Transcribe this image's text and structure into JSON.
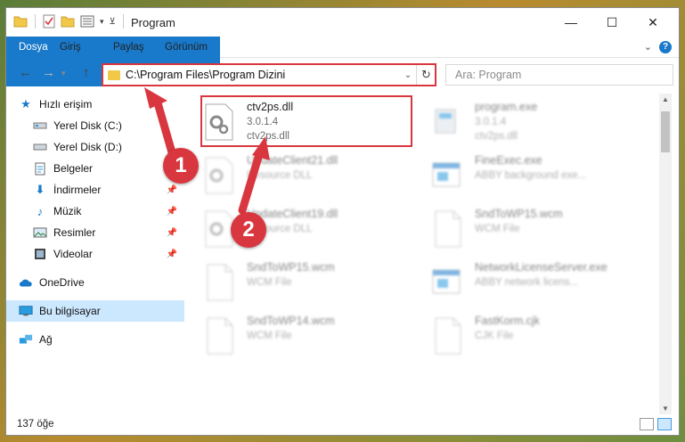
{
  "window": {
    "title": "Program",
    "controls": {
      "minimize": "—",
      "maximize": "☐",
      "close": "✕"
    }
  },
  "ribbon": {
    "tabs": [
      "Dosya",
      "Giriş",
      "Paylaş",
      "Görünüm"
    ],
    "help": "?"
  },
  "address_bar": {
    "path": "C:\\Program Files\\Program Dizini",
    "search_placeholder": "Ara: Program"
  },
  "sidebar": {
    "quick_access": "Hızlı erişim",
    "items": [
      {
        "label": "Yerel Disk (C:)",
        "icon": "drive-icon"
      },
      {
        "label": "Yerel Disk (D:)",
        "icon": "drive-icon"
      },
      {
        "label": "Belgeler",
        "icon": "documents-icon"
      },
      {
        "label": "İndirmeler",
        "icon": "downloads-icon",
        "pinned": true
      },
      {
        "label": "Müzik",
        "icon": "music-icon",
        "pinned": true
      },
      {
        "label": "Resimler",
        "icon": "pictures-icon",
        "pinned": true
      },
      {
        "label": "Videolar",
        "icon": "videos-icon",
        "pinned": true
      }
    ],
    "onedrive": "OneDrive",
    "this_pc": "Bu bilgisayar",
    "network": "Ağ"
  },
  "files": [
    {
      "name": "ctv2ps.dll",
      "line1": "3.0.1.4",
      "line2": "ctv2ps.dll",
      "icon": "dll-gear-icon",
      "highlighted": true
    },
    {
      "name": "program.exe",
      "line1": "3.0.1.4",
      "line2": "ctv2ps.dll",
      "icon": "exe-icon"
    },
    {
      "name": "UpdateClient21.dll",
      "line1": "Resource DLL",
      "line2": "",
      "icon": "dll-gear-icon"
    },
    {
      "name": "FineExec.exe",
      "line1": "ABBY background exe...",
      "line2": "",
      "icon": "app-window-icon"
    },
    {
      "name": "UpdateClient19.dll",
      "line1": "Resource DLL",
      "line2": "",
      "icon": "dll-gear-icon"
    },
    {
      "name": "SndToWP15.wcm",
      "line1": "WCM File",
      "line2": "",
      "icon": "blank-file-icon"
    },
    {
      "name": "SndToWP15.wcm",
      "line1": "WCM File",
      "line2": "",
      "icon": "blank-file-icon"
    },
    {
      "name": "NetworkLicenseServer.exe",
      "line1": "ABBY network licens...",
      "line2": "",
      "icon": "app-window-icon"
    },
    {
      "name": "SndToWP14.wcm",
      "line1": "WCM File",
      "line2": "",
      "icon": "blank-file-icon"
    },
    {
      "name": "FastKorm.cjk",
      "line1": "CJK File",
      "line2": "",
      "icon": "blank-file-icon"
    }
  ],
  "status": {
    "item_count": "137 öğe"
  },
  "callouts": [
    "1",
    "2"
  ],
  "colors": {
    "accent": "#1979ca",
    "highlight": "#d9373f",
    "selected": "#cce8ff"
  }
}
